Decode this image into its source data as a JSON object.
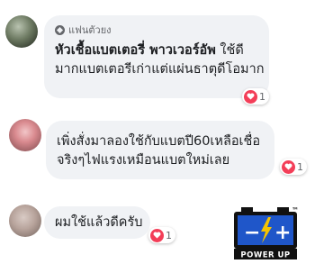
{
  "comments": [
    {
      "badge": "แฟนตัวยง",
      "lines": [
        "หัวเชื้อแบตเตอรี่ พาวเวอร์อัพ",
        "ใช้ดี",
        "มากแบตเตอรีเก่าแต่แผ่นธาตุดีโอมาก"
      ],
      "reaction": {
        "icon": "heart-icon",
        "count": "1"
      }
    },
    {
      "lines": [
        "เพิ่งสั่งมาลองใช้กับแบตปี60เหลือเชื่อ",
        "จริงๆไฟแรงเหมือนแบตใหม่เลย"
      ],
      "reaction": {
        "icon": "heart-icon",
        "count": "1"
      }
    },
    {
      "lines": [
        "ผมใช้แล้วดีครับ"
      ],
      "reaction": {
        "icon": "heart-icon",
        "count": "1"
      }
    }
  ],
  "logo": {
    "tm": "™",
    "minus": "−",
    "plus": "+",
    "text": "POWER UP"
  },
  "colors": {
    "bubble": "#f0f2f5",
    "heart": "#f33e58",
    "logo_blue": "#1f56c9",
    "logo_yellow": "#f5c400",
    "logo_black": "#111111"
  }
}
